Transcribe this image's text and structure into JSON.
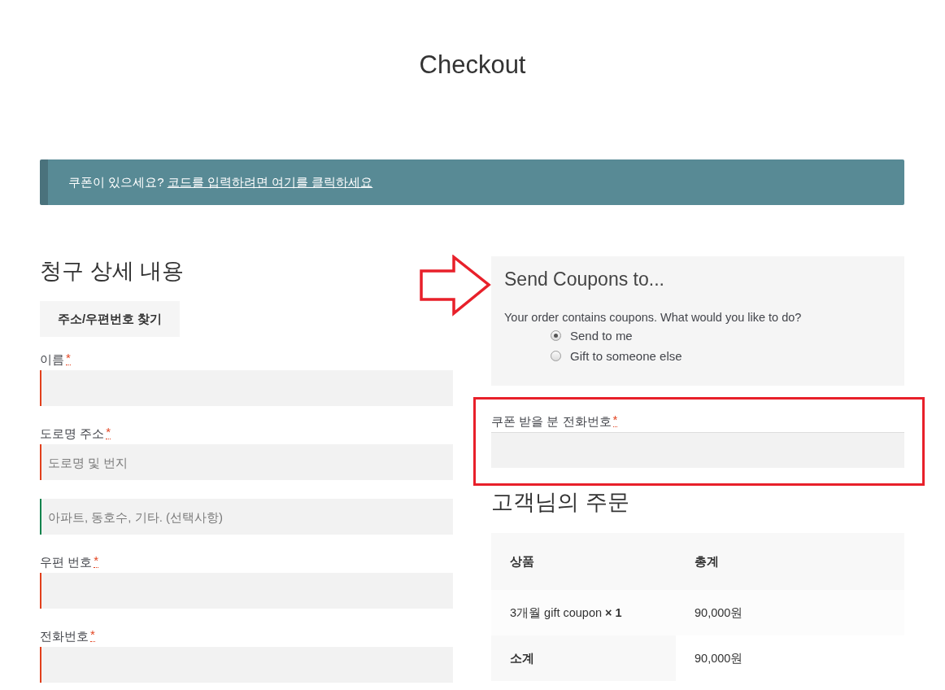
{
  "page_title": "Checkout",
  "coupon_notice": {
    "text": "쿠폰이 있으세요?",
    "link": "코드를 입력하려면 여기를 클릭하세요"
  },
  "billing": {
    "heading": "청구 상세 내용",
    "address_button": "주소/우편번호 찾기",
    "fields": [
      {
        "label": "이름",
        "mark": "*",
        "invalid": true
      },
      {
        "label": "도로명 주소",
        "mark": "*",
        "placeholder": "도로명 및 번지",
        "invalid": true
      },
      {
        "placeholder": "아파트, 동호수, 기타. (선택사항)",
        "invalid": false
      },
      {
        "label": "우편 번호",
        "mark": "*",
        "invalid": true
      },
      {
        "label": "전화번호",
        "mark": "*",
        "invalid": true
      }
    ]
  },
  "coupon_panel": {
    "heading": "Send Coupons to...",
    "question": "Your order contains coupons. What would you like to do?",
    "options": [
      {
        "label": "Send to me",
        "selected": true
      },
      {
        "label": "Gift to someone else",
        "selected": false
      }
    ]
  },
  "recipient_phone": {
    "label": "쿠폰 받을 분 전화번호",
    "mark": "*"
  },
  "order": {
    "heading": "고객님의 주문",
    "columns": [
      "상품",
      "총계"
    ],
    "rows": [
      {
        "kind": "item",
        "cells": [
          "3개월 gift coupon **× 1**",
          "90,000원"
        ]
      },
      {
        "kind": "subtotal",
        "cells": [
          "소계",
          "90,000원"
        ]
      }
    ]
  }
}
